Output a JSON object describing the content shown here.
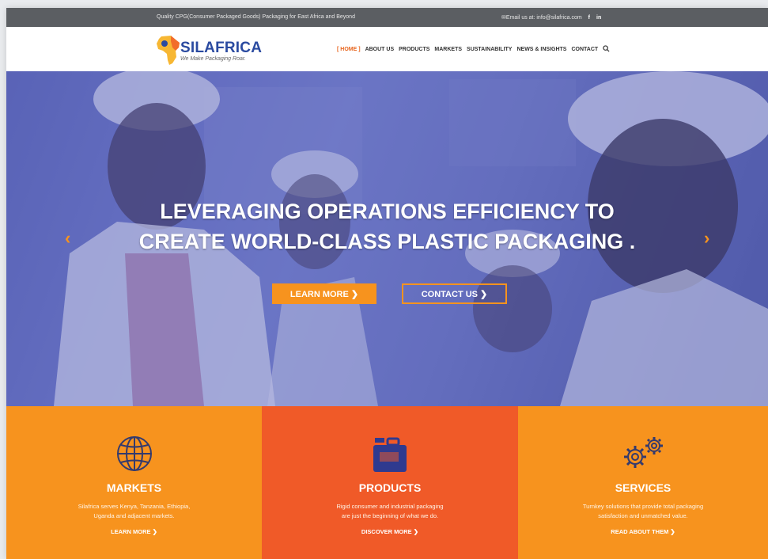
{
  "topbar": {
    "tagline": "Quality CPG(Consumer Packaged Goods) Packaging for East Africa and Beyond",
    "email": "✉Email us at: info@silafrica.com",
    "social": [
      "f",
      "in"
    ]
  },
  "header": {
    "brand": "SILAFRICA",
    "slogan": "We Make Packaging Roar.",
    "nav": [
      "[ HOME ]",
      "ABOUT US",
      "PRODUCTS",
      "MARKETS",
      "SUSTAINABILITY",
      "NEWS & INSIGHTS",
      "CONTACT"
    ],
    "active_nav": "[ HOME ]"
  },
  "hero": {
    "headline_1": "LEVERAGING OPERATIONS EFFICIENCY TO",
    "headline_2": "CREATE WORLD-CLASS PLASTIC PACKAGING .",
    "learn_more": "LEARN MORE ❯",
    "contact_us": "CONTACT US ❯",
    "prev": "‹",
    "next": "›"
  },
  "panels": {
    "markets": {
      "title": "MARKETS",
      "desc_1": "Silafrica serves Kenya, Tanzania, Ethiopia,",
      "desc_2": "Uganda and adjacent markets.",
      "link": "LEARN MORE ❯"
    },
    "products": {
      "title": "PRODUCTS",
      "desc_1": "Rigid consumer and industrial packaging",
      "desc_2": "are just the beginning of what we do.",
      "link": "DISCOVER MORE ❯"
    },
    "services": {
      "title": "SERVICES",
      "desc_1": "Turnkey solutions that provide total packaging",
      "desc_2": "satisfaction and unmatched value.",
      "link": "READ ABOUT THEM ❯"
    }
  },
  "colors": {
    "orange": "#f7931e",
    "red_orange": "#f05a28",
    "brand_blue": "#2a4aa0",
    "topbar": "#5b5e62"
  }
}
